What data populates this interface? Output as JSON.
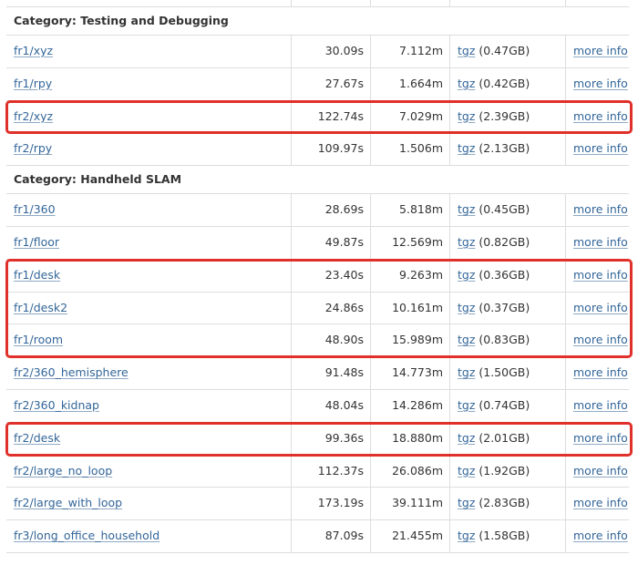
{
  "categories": [
    {
      "label": "Category: Testing and Debugging",
      "rows": [
        {
          "name": "fr1/xyz",
          "duration": "30.09s",
          "length": "7.112m",
          "download_link": "tgz",
          "size": "(0.47GB)",
          "info": "more info"
        },
        {
          "name": "fr1/rpy",
          "duration": "27.67s",
          "length": "1.664m",
          "download_link": "tgz",
          "size": "(0.42GB)",
          "info": "more info"
        },
        {
          "name": "fr2/xyz",
          "duration": "122.74s",
          "length": "7.029m",
          "download_link": "tgz",
          "size": "(2.39GB)",
          "info": "more info"
        },
        {
          "name": "fr2/rpy",
          "duration": "109.97s",
          "length": "1.506m",
          "download_link": "tgz",
          "size": "(2.13GB)",
          "info": "more info"
        }
      ]
    },
    {
      "label": "Category: Handheld SLAM",
      "rows": [
        {
          "name": "fr1/360",
          "duration": "28.69s",
          "length": "5.818m",
          "download_link": "tgz",
          "size": "(0.45GB)",
          "info": "more info"
        },
        {
          "name": "fr1/floor",
          "duration": "49.87s",
          "length": "12.569m",
          "download_link": "tgz",
          "size": "(0.82GB)",
          "info": "more info"
        },
        {
          "name": "fr1/desk",
          "duration": "23.40s",
          "length": "9.263m",
          "download_link": "tgz",
          "size": "(0.36GB)",
          "info": "more info"
        },
        {
          "name": "fr1/desk2",
          "duration": "24.86s",
          "length": "10.161m",
          "download_link": "tgz",
          "size": "(0.37GB)",
          "info": "more info"
        },
        {
          "name": "fr1/room",
          "duration": "48.90s",
          "length": "15.989m",
          "download_link": "tgz",
          "size": "(0.83GB)",
          "info": "more info"
        },
        {
          "name": "fr2/360_hemisphere",
          "duration": "91.48s",
          "length": "14.773m",
          "download_link": "tgz",
          "size": "(1.50GB)",
          "info": "more info"
        },
        {
          "name": "fr2/360_kidnap",
          "duration": "48.04s",
          "length": "14.286m",
          "download_link": "tgz",
          "size": "(0.74GB)",
          "info": "more info"
        },
        {
          "name": "fr2/desk",
          "duration": "99.36s",
          "length": "18.880m",
          "download_link": "tgz",
          "size": "(2.01GB)",
          "info": "more info"
        },
        {
          "name": "fr2/large_no_loop",
          "duration": "112.37s",
          "length": "26.086m",
          "download_link": "tgz",
          "size": "(1.92GB)",
          "info": "more info"
        },
        {
          "name": "fr2/large_with_loop",
          "duration": "173.19s",
          "length": "39.111m",
          "download_link": "tgz",
          "size": "(2.83GB)",
          "info": "more info"
        },
        {
          "name": "fr3/long_office_household",
          "duration": "87.09s",
          "length": "21.455m",
          "download_link": "tgz",
          "size": "(1.58GB)",
          "info": "more info"
        }
      ]
    }
  ],
  "highlighted_rows": [
    "fr2/xyz",
    "fr1/desk",
    "fr1/desk2",
    "fr1/room",
    "fr2/desk"
  ],
  "colors": {
    "highlight": "#e0302a",
    "link": "#336699",
    "grid": "#dddddd"
  }
}
